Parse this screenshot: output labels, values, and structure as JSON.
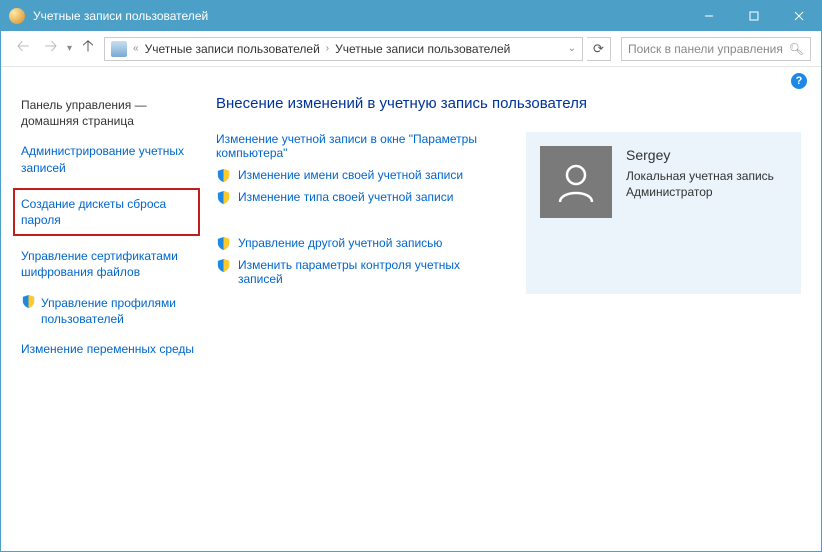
{
  "titlebar": {
    "title": "Учетные записи пользователей"
  },
  "breadcrumb": {
    "prefix": "«",
    "items": [
      "Учетные записи пользователей",
      "Учетные записи пользователей"
    ]
  },
  "search": {
    "placeholder": "Поиск в панели управления"
  },
  "sidebar": {
    "home": "Панель управления — домашняя страница",
    "items": [
      {
        "label": "Администрирование учетных записей",
        "shield": false,
        "boxed": false
      },
      {
        "label": "Создание дискеты сброса пароля",
        "shield": false,
        "boxed": true
      },
      {
        "label": "Управление сертификатами шифрования файлов",
        "shield": false,
        "boxed": false
      },
      {
        "label": "Управление профилями пользователей",
        "shield": true,
        "boxed": false
      },
      {
        "label": "Изменение переменных среды",
        "shield": false,
        "boxed": false
      }
    ]
  },
  "main": {
    "heading": "Внесение изменений в учетную запись пользователя",
    "group1": [
      {
        "label": "Изменение учетной записи в окне \"Параметры компьютера\"",
        "shield": false
      },
      {
        "label": "Изменение имени своей учетной записи",
        "shield": true
      },
      {
        "label": "Изменение типа своей учетной записи",
        "shield": true
      }
    ],
    "group2": [
      {
        "label": "Управление другой учетной записью",
        "shield": true
      },
      {
        "label": "Изменить параметры контроля учетных записей",
        "shield": true
      }
    ]
  },
  "account": {
    "name": "Sergey",
    "type": "Локальная учетная запись",
    "role": "Администратор"
  }
}
